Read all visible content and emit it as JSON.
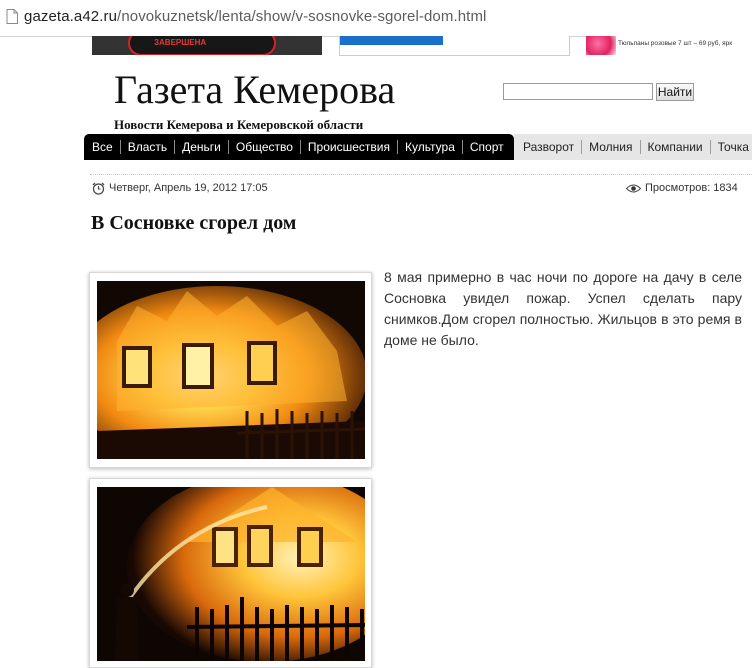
{
  "browser": {
    "url_domain": "gazeta.a42.ru",
    "url_path": "/novokuznetsk/lenta/show/v-sosnovke-sgorel-dom.html"
  },
  "banners": {
    "banner1_text": "ЗАВЕРШЕНА",
    "banner3_text": "Тюльпаны розовые 7 шт – 69 руб, ярк"
  },
  "header": {
    "logo": "Газета Кемерова",
    "subtitle": "Новости Кемерова и Кемеровской области",
    "search_placeholder": "",
    "search_button": "Найти"
  },
  "nav": {
    "primary": [
      "Все",
      "Власть",
      "Деньги",
      "Общество",
      "Происшествия",
      "Культура",
      "Спорт"
    ],
    "secondary": [
      "Разворот",
      "Молния",
      "Компании",
      "Точка зр"
    ]
  },
  "article": {
    "date": "Четверг, Апрель 19, 2012 17:05",
    "views": "Просмотров: 1834",
    "title": "В Сосновке сгорел дом",
    "body": "8 мая примерно  в час ночи  по дороге на дачу в селе Сосновка увидел пожар. Успел сделать пару снимков.Дом сгорел полностью. Жильцов в это ремя в доме не было."
  },
  "colors": {
    "nav_dark": "#000000",
    "nav_light": "#e6e6e6",
    "fire": "#ff9a1f"
  }
}
